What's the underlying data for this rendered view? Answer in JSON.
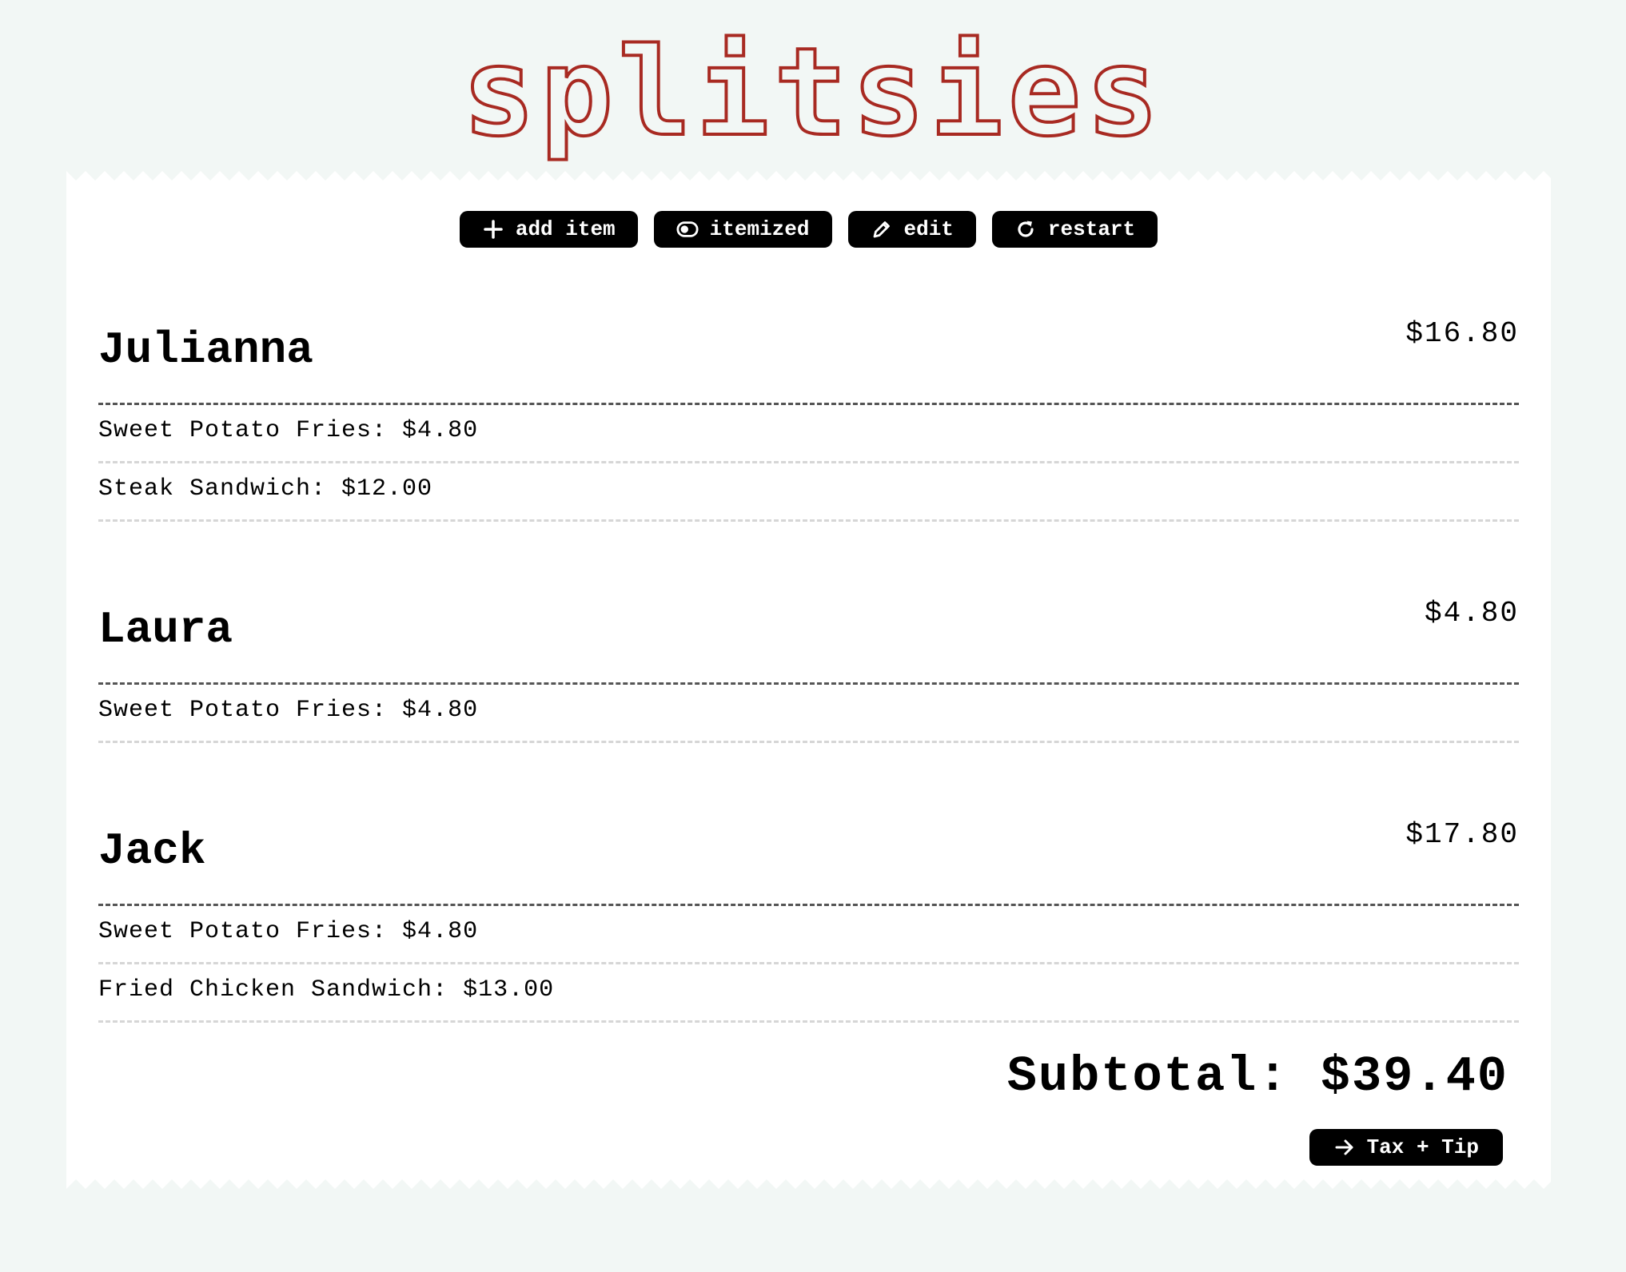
{
  "app": {
    "title": "splitsies"
  },
  "toolbar": {
    "add_item": "add item",
    "itemized": "itemized",
    "edit": "edit",
    "restart": "restart"
  },
  "people": [
    {
      "name": "Julianna",
      "total": "$16.80",
      "items": [
        "Sweet Potato Fries: $4.80",
        "Steak Sandwich: $12.00"
      ]
    },
    {
      "name": "Laura",
      "total": "$4.80",
      "items": [
        "Sweet Potato Fries: $4.80"
      ]
    },
    {
      "name": "Jack",
      "total": "$17.80",
      "items": [
        "Sweet Potato Fries: $4.80",
        "Fried Chicken Sandwich: $13.00"
      ]
    }
  ],
  "summary": {
    "subtotal": "Subtotal: $39.40",
    "next_label": "Tax + Tip"
  },
  "colors": {
    "brand": "#a82a22",
    "background": "#f2f7f5",
    "button": "#000000"
  },
  "icons": {
    "add": "plus-icon",
    "itemized": "toggle-icon",
    "edit": "pencil-icon",
    "restart": "rotate-icon",
    "next": "arrow-right-icon"
  }
}
